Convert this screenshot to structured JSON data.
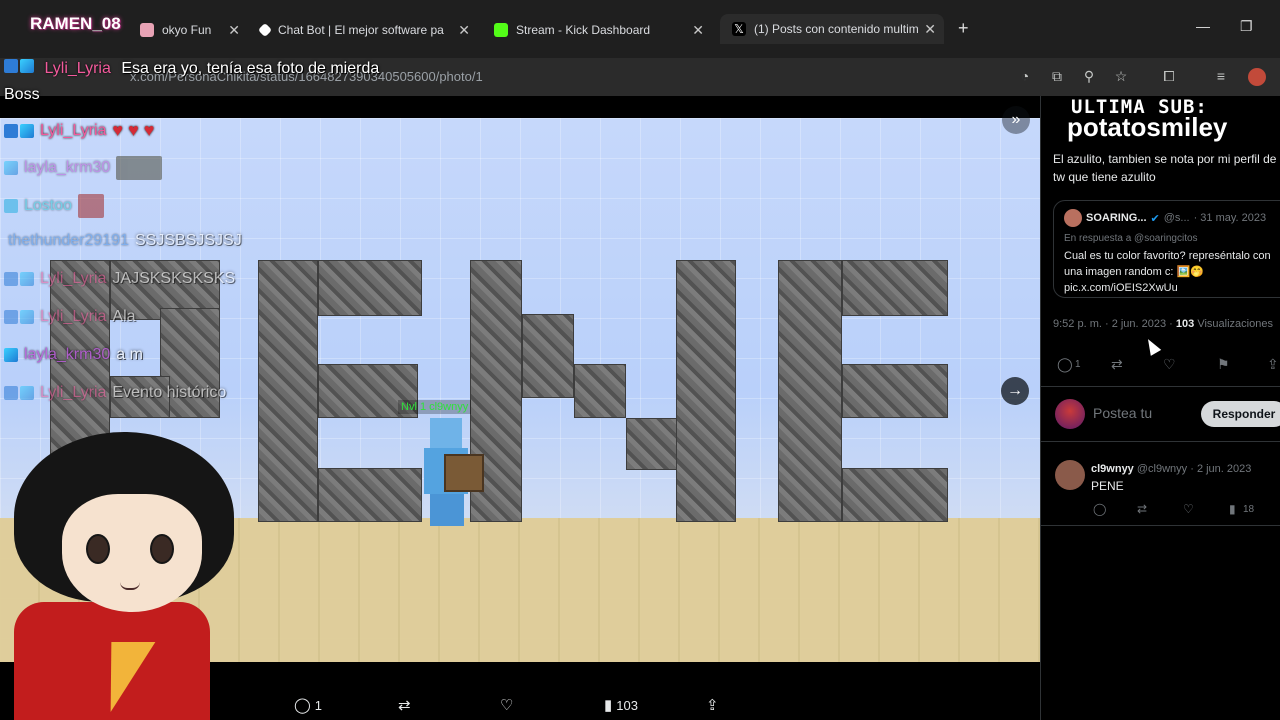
{
  "browser": {
    "tabs": [
      {
        "label": "okyo Fun",
        "active": false
      },
      {
        "label": "Chat Bot | El mejor software pa",
        "active": false
      },
      {
        "label": "Stream - Kick Dashboard",
        "active": false
      },
      {
        "label": "(1) Posts con contenido multim",
        "active": true
      }
    ],
    "url": "x.com/PersonaChikita/status/166482739034050560​0/photo/1"
  },
  "viewer": {
    "nametag": "Nvl 1 cl9wnyy",
    "actions": {
      "reply_count": "1",
      "views_count": "103"
    }
  },
  "overlay": {
    "channel": "RAMEN_08",
    "ultima_sub_label": "ULTIMA SUB:",
    "ultima_sub_name": "potatosmiley",
    "chat": [
      {
        "user": "Lyli_Lyria",
        "text": "Esa era yo, tenía esa foto de mierda Boss"
      },
      {
        "user": "Lyli_Lyria",
        "text": "♥ ♥ ♥"
      },
      {
        "user": "layla_krm30",
        "text": ""
      },
      {
        "user": "Lostoo",
        "text": ""
      },
      {
        "user": "thethunder29191",
        "text": "SSJSBSJSJSJ"
      },
      {
        "user": "Lyli_Lyria",
        "text": "JAJSKSKSKSKS"
      },
      {
        "user": "Lyli_Lyria",
        "text": "Ala"
      },
      {
        "user": "layla_krm30",
        "text": "a m"
      },
      {
        "user": "Lyli_Lyria",
        "text": "Evento histórico"
      }
    ]
  },
  "tweet": {
    "text": "El azulito, tambien se nota por mi perfil de tw que tiene azulito",
    "quote": {
      "name": "SOARING...",
      "handle": "@s...",
      "date": "· 31 may. 2023",
      "reply_to": "En respuesta a @soaringcitos",
      "text": "Cual es tu color favorito? represéntalo con una imagen random c: 🖼️🤭 pic.x.com/iOEIS2XwUu"
    },
    "time": "9:52 p. m. · 2 jun. 2023 ·",
    "views": "103",
    "views_label": "Visualizaciones",
    "reply_count": "1",
    "reply_placeholder": "Postea tu",
    "reply_button": "Responder"
  },
  "comment": {
    "name": "cl9wnyy",
    "handle": "@cl9wnyy · 2 jun. 2023",
    "text": "PENE",
    "views": "18"
  }
}
